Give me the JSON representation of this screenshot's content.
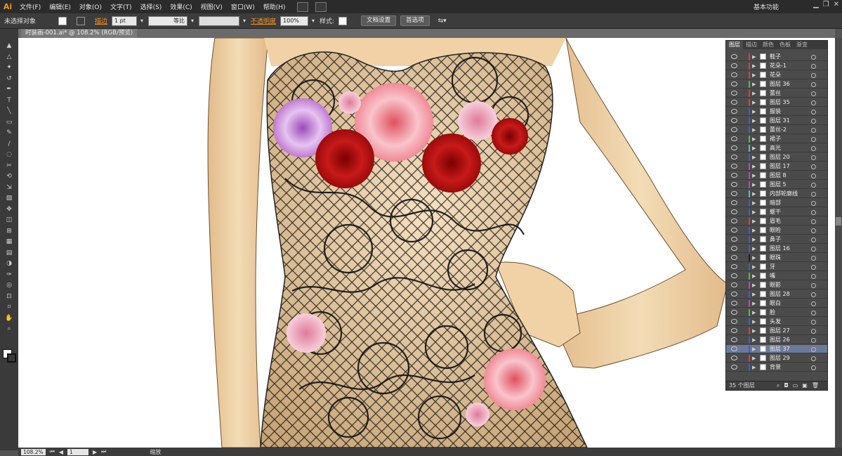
{
  "app": {
    "logo": "Ai"
  },
  "menu": [
    "文件(F)",
    "编辑(E)",
    "对象(O)",
    "文字(T)",
    "选择(S)",
    "效果(C)",
    "视图(V)",
    "窗口(W)",
    "帮助(H)"
  ],
  "workspace": "基本功能",
  "control": {
    "selection": "未选择对象",
    "stroke_label": "描边",
    "stroke_weight": "1 pt",
    "profile": "等比",
    "opacity_label": "不透明度",
    "opacity": "100%",
    "style_label": "样式:",
    "doc_setup": "文档设置",
    "prefs": "首选项"
  },
  "doc_tab": "时装画-001.ai* @ 108.2% (RGB/预览)",
  "status": {
    "zoom": "108.2%",
    "page": "1",
    "mode": "缩放"
  },
  "panel": {
    "tabs": [
      "图层",
      "描边",
      "颜色",
      "色板",
      "渐变"
    ],
    "count": "35 个图层",
    "layers": [
      {
        "name": "鞋子",
        "color": "#e03c3c"
      },
      {
        "name": "花朵-1",
        "color": "#e03c3c"
      },
      {
        "name": "花朵",
        "color": "#e03c3c"
      },
      {
        "name": "图层 36",
        "color": "#3cc83c"
      },
      {
        "name": "蕾丝",
        "color": "#e03c3c"
      },
      {
        "name": "图层 35",
        "color": "#e03c3c"
      },
      {
        "name": "服装",
        "color": "#3c5ae0"
      },
      {
        "name": "图层 31",
        "color": "#3c5ae0"
      },
      {
        "name": "蕾丝-2",
        "color": "#3c5ae0"
      },
      {
        "name": "裙子",
        "color": "#3cc83c"
      },
      {
        "name": "高光",
        "color": "#3cc8c8"
      },
      {
        "name": "图层 20",
        "color": "#3c5ae0"
      },
      {
        "name": "图层 17",
        "color": "#c83cc8"
      },
      {
        "name": "图层 8",
        "color": "#c83cc8"
      },
      {
        "name": "图层 5",
        "color": "#c83cc8"
      },
      {
        "name": "内部轮廓线",
        "color": "#3cc8c8"
      },
      {
        "name": "暗部",
        "color": "#3c5ae0"
      },
      {
        "name": "躯干",
        "color": "#3c5ae0"
      },
      {
        "name": "眉毛",
        "color": "#e03c3c"
      },
      {
        "name": "眼睑",
        "color": "#3c5ae0"
      },
      {
        "name": "鼻子",
        "color": "#3c5ae0"
      },
      {
        "name": "图层 16",
        "color": "#3c5ae0"
      },
      {
        "name": "眼珠",
        "color": "#222222"
      },
      {
        "name": "牙",
        "color": "#3c5ae0"
      },
      {
        "name": "嘴",
        "color": "#3cc83c"
      },
      {
        "name": "眼影",
        "color": "#c83cc8"
      },
      {
        "name": "图层 28",
        "color": "#3c5ae0"
      },
      {
        "name": "眼白",
        "color": "#c83cc8"
      },
      {
        "name": "脸",
        "color": "#3cc83c"
      },
      {
        "name": "头发",
        "color": "#3c5ae0"
      },
      {
        "name": "图层 27",
        "color": "#e03c3c"
      },
      {
        "name": "图层 26",
        "color": "#3c5ae0"
      },
      {
        "name": "图层 37",
        "color": "#3c5ae0",
        "selected": true
      },
      {
        "name": "图层 29",
        "color": "#e03c3c"
      },
      {
        "name": "背景",
        "color": "#3c5ae0"
      }
    ]
  },
  "colors": {
    "skin": "#f0d2a6",
    "skin_shadow": "#e2bb8a",
    "lace": "#1a1a1a",
    "rose_red": "#c81a1a",
    "rose_pink": "#f08a96",
    "rose_purple": "#c07ad0",
    "rose_light": "#f2b2c4"
  }
}
